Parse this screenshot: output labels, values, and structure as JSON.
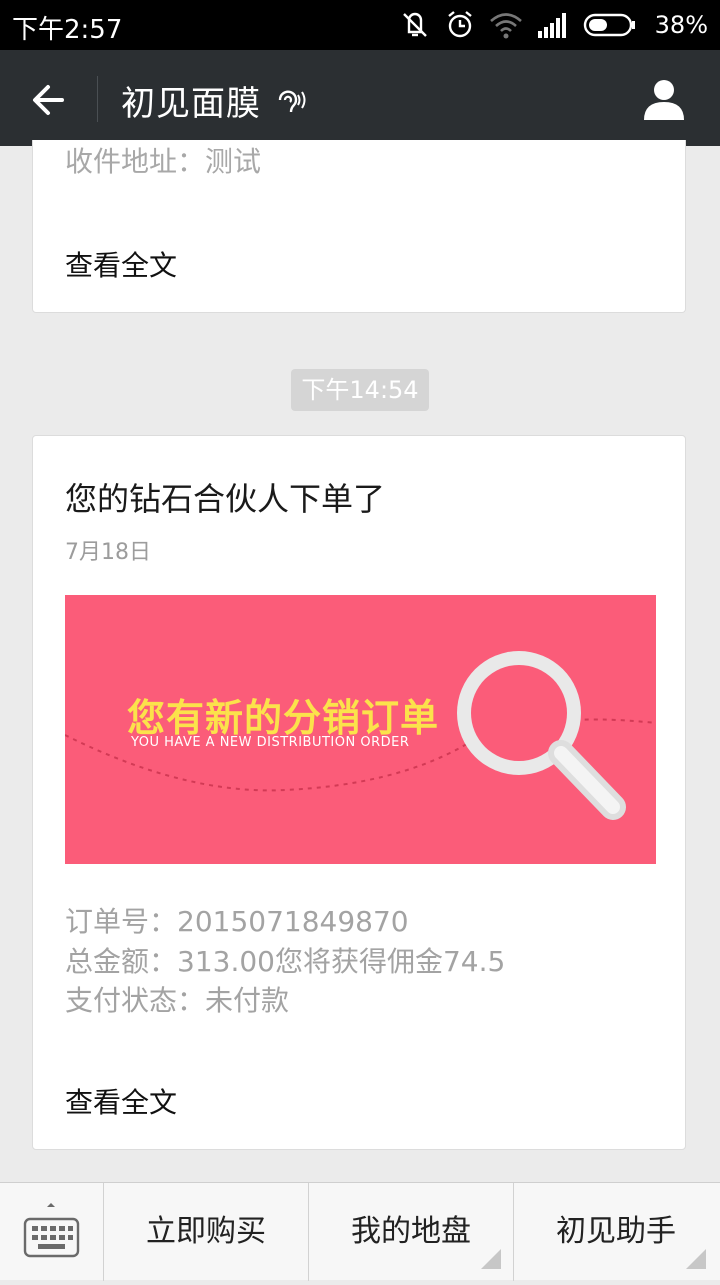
{
  "status_bar": {
    "time": "下午2:57",
    "battery": "38%",
    "icons": [
      "mute-icon",
      "alarm-icon",
      "wifi-icon",
      "signal-icon",
      "battery-icon"
    ]
  },
  "header": {
    "title": "初见面膜",
    "back_icon": "back-arrow-icon",
    "profile_icon": "profile-icon"
  },
  "messages": [
    {
      "address_line": "收件地址：测试",
      "read_more": "查看全文"
    },
    {
      "timestamp": "下午14:54",
      "title": "您的钻石合伙人下单了",
      "date": "7月18日",
      "banner": {
        "headline": "您有新的分销订单",
        "subline": "YOU HAVE A NEW DISTRIBUTION ORDER"
      },
      "order_no": "订单号：2015071849870",
      "total": "总金额：313.00您将获得佣金74.5",
      "pay_status": "支付状态：未付款",
      "read_more": "查看全文"
    }
  ],
  "bottom_menu": {
    "keyboard_icon": "keyboard-icon",
    "items": [
      "立即购买",
      "我的地盘",
      "初见助手"
    ]
  },
  "colors": {
    "banner_bg": "#fb5c79",
    "banner_headline": "#fbe24b",
    "title_bar": "#2b2f32"
  }
}
